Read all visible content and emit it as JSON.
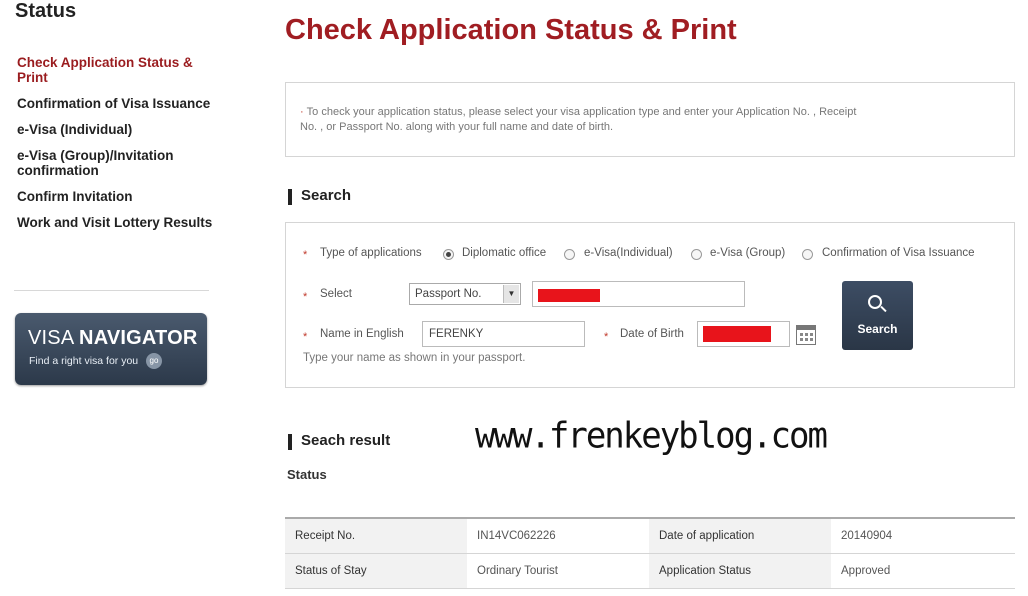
{
  "sidebar": {
    "heading": "Status",
    "items": [
      {
        "label": "Check Application Status & Print",
        "active": true
      },
      {
        "label": "Confirmation of Visa Issuance"
      },
      {
        "label": "e-Visa (Individual)"
      },
      {
        "label": "e-Visa (Group)/Invitation confirmation"
      },
      {
        "label": "Confirm Invitation"
      },
      {
        "label": "Work and Visit Lottery Results"
      }
    ],
    "banner": {
      "visa": "VISA",
      "navigator": "NAVIGATOR",
      "subtitle": "Find a right visa for you",
      "go": "go"
    }
  },
  "main": {
    "title": "Check Application Status & Print",
    "info": "To check your application status, please select your visa application type and enter your Application No. , Receipt No. , or Passport No. along with your full name and date of birth.",
    "search": {
      "heading": "Search",
      "type_label": "Type of applications",
      "types": [
        "Diplomatic office",
        "e-Visa(Individual)",
        "e-Visa (Group)",
        "Confirmation of Visa Issuance"
      ],
      "selected_type": "Diplomatic office",
      "select_label": "Select",
      "select_value": "Passport No.",
      "name_label": "Name in English",
      "name_value": "FERENKY",
      "dob_label": "Date of Birth",
      "hint": "Type your name as shown in your passport.",
      "button": "Search"
    },
    "result": {
      "heading": "Seach result",
      "status_label": "Status",
      "rows": [
        [
          "Receipt No.",
          "IN14VC062226",
          "Date of application",
          "20140904"
        ],
        [
          "Status of Stay",
          "Ordinary Tourist",
          "Application Status",
          "Approved"
        ]
      ]
    },
    "watermark": "www.frenkeyblog.com"
  },
  "colors": {
    "accent": "#a01d22",
    "redaction": "#e8141b",
    "button": "#2f3c4f"
  }
}
